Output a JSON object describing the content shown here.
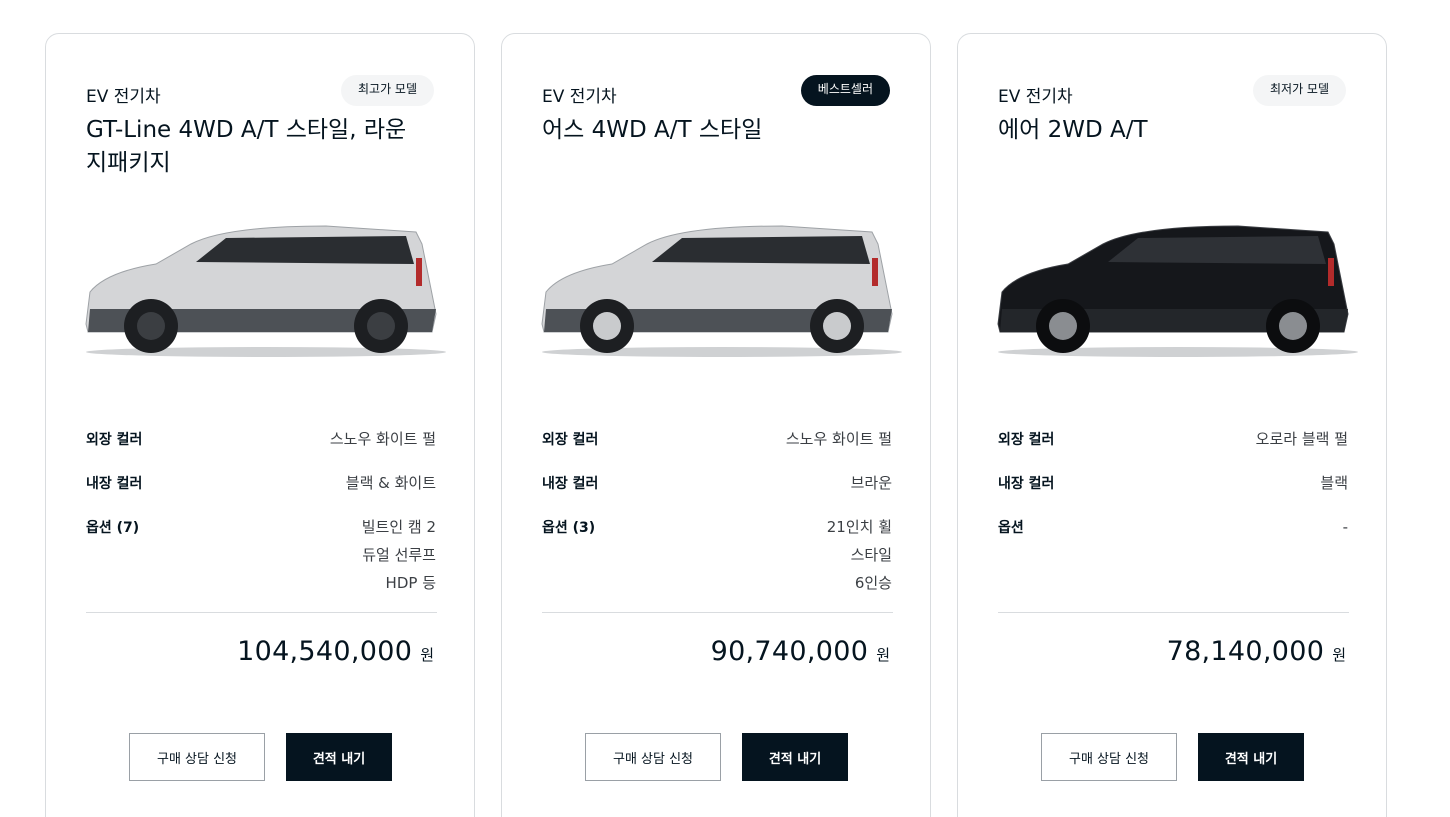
{
  "cards": [
    {
      "category": "EV 전기차",
      "badge": "최고가 모델",
      "title": "GT-Line 4WD A/T 스타일, 라운지패키지",
      "car_color": "#d4d5d7",
      "specs": {
        "exterior_label": "외장 컬러",
        "exterior_value": "스노우 화이트 펄",
        "interior_label": "내장 컬러",
        "interior_value": "블랙 & 화이트",
        "options_label": "옵션 (7)",
        "options_values": [
          "빌트인 캠 2",
          "듀얼 선루프",
          "HDP 등"
        ]
      },
      "price": "104,540,000",
      "price_unit": "원",
      "consult_button": "구매 상담 신청",
      "estimate_button": "견적 내기"
    },
    {
      "category": "EV 전기차",
      "badge": "베스트셀러",
      "title": "어스 4WD A/T 스타일",
      "car_color": "#d4d5d7",
      "specs": {
        "exterior_label": "외장 컬러",
        "exterior_value": "스노우 화이트 펄",
        "interior_label": "내장 컬러",
        "interior_value": "브라운",
        "options_label": "옵션 (3)",
        "options_values": [
          "21인치 휠",
          "스타일",
          "6인승"
        ]
      },
      "price": "90,740,000",
      "price_unit": "원",
      "consult_button": "구매 상담 신청",
      "estimate_button": "견적 내기"
    },
    {
      "category": "EV 전기차",
      "badge": "최저가 모델",
      "title": "에어 2WD A/T",
      "car_color": "#15171b",
      "specs": {
        "exterior_label": "외장 컬러",
        "exterior_value": "오로라 블랙 펄",
        "interior_label": "내장 컬러",
        "interior_value": "블랙",
        "options_label": "옵션",
        "options_values": [
          "-"
        ]
      },
      "price": "78,140,000",
      "price_unit": "원",
      "consult_button": "구매 상담 신청",
      "estimate_button": "견적 내기"
    }
  ],
  "colors": {
    "brand_dark": "#05141f",
    "badge_light": "#f4f5f6",
    "border": "#d9dcdf"
  }
}
